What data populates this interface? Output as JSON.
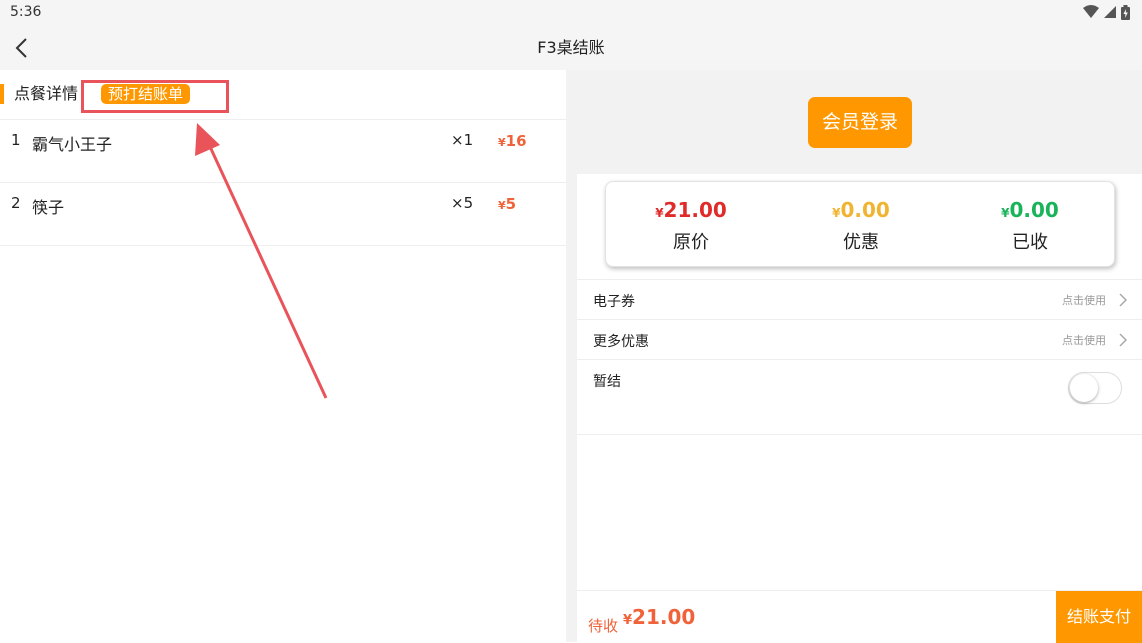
{
  "status_bar": {
    "time": "5:36"
  },
  "header": {
    "title": "F3桌结账"
  },
  "order": {
    "section_title": "点餐详情",
    "print_button": "预打结账单",
    "currency_symbol": "¥",
    "items": [
      {
        "index": "1",
        "name": "霸气小王子",
        "qty": "×1",
        "price": "16"
      },
      {
        "index": "2",
        "name": "筷子",
        "qty": "×5",
        "price": "5"
      }
    ]
  },
  "checkout": {
    "member_login": "会员登录",
    "currency_symbol": "¥",
    "summary": [
      {
        "amount": "21.00",
        "label": "原价",
        "color": "#e02b2b"
      },
      {
        "amount": "0.00",
        "label": "优惠",
        "color": "#f0b430"
      },
      {
        "amount": "0.00",
        "label": "已收",
        "color": "#19b35a"
      }
    ],
    "options": [
      {
        "label": "电子券",
        "action": "点击使用"
      },
      {
        "label": "更多优惠",
        "action": "点击使用"
      }
    ],
    "suspend": {
      "label": "暂结",
      "on": false
    },
    "due_label": "待收",
    "due_amount": "21.00",
    "pay_button": "结账支付"
  },
  "colors": {
    "accent": "#ff9800",
    "annotation": "#e8545a",
    "price": "#f0633a"
  }
}
